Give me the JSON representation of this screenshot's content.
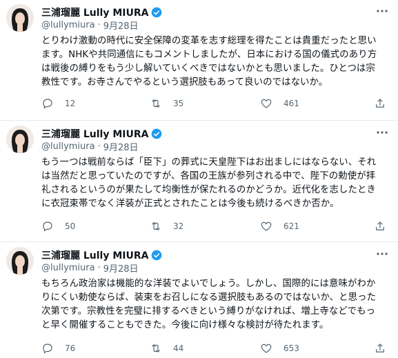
{
  "tweets": [
    {
      "author": {
        "display_name": "三浦瑠麗 Lully MIURA",
        "handle": "@lullymiura",
        "date": "9月28日"
      },
      "lines": [
        "とりわけ激動の時代に安全保障の変革を志す総理を得たことは貴重だったと思い",
        "ます。NHKや共同通信にもコメントしましたが、日本における国の儀式のあり方",
        "は戦後の縛りをもう少し解いていくべきではないかとも思いました。ひとつは宗",
        "教性です。お寺さんでやるという選択肢もあって良いのではないか。"
      ],
      "replies": "12",
      "retweets": "35",
      "likes": "461"
    },
    {
      "author": {
        "display_name": "三浦瑠麗 Lully MIURA",
        "handle": "@lullymiura",
        "date": "9月28日"
      },
      "lines": [
        "もう一つは戦前ならば「臣下」の葬式に天皇陛下はお出ましにはならない、それ",
        "は当然だと思っていたのですが、各国の王族が参列される中で、陛下の勅使が拝",
        "礼されるというのが果たして均衡性が保たれるのかどうか。近代化を志したとき",
        "に衣冠束帯でなく洋装が正式とされたことは今後も続けるべきか否か。"
      ],
      "replies": "50",
      "retweets": "32",
      "likes": "621"
    },
    {
      "author": {
        "display_name": "三浦瑠麗 Lully MIURA",
        "handle": "@lullymiura",
        "date": "9月28日"
      },
      "lines": [
        "もちろん政治家は機能的な洋装でよいでしょう。しかし、国際的には意味がわか",
        "りにくい勅使ならば、装束をお召しになる選択肢もあるのではないか、と思った",
        "次第です。宗教性を完璧に排するべきという縛りがなければ、増上寺などでもっ",
        "と早く開催することもできた。今後に向け様々な検討が待たれます。"
      ],
      "replies": "76",
      "retweets": "44",
      "likes": "653"
    }
  ],
  "icons": {
    "reply": "reply-icon",
    "retweet": "retweet-icon",
    "like": "like-icon",
    "share": "share-icon",
    "more": "more-icon",
    "verified": "verified-badge-icon"
  },
  "colors": {
    "verified": "#1d9bf0",
    "muted": "#536471",
    "text": "#0f1419"
  }
}
